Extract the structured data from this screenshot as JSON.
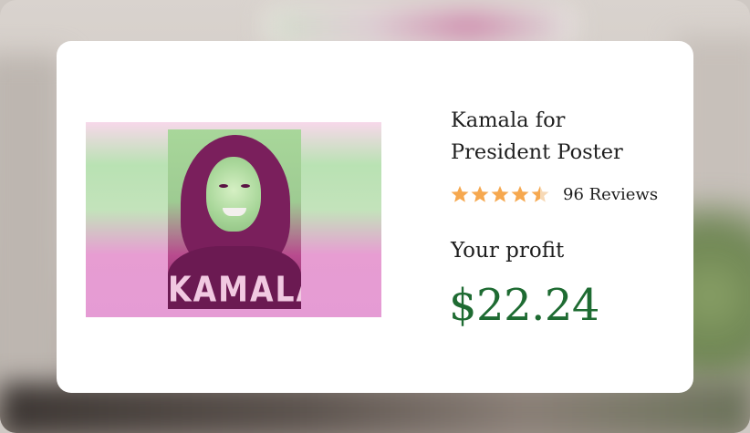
{
  "product": {
    "title_line1": "Kamala for",
    "title_line2": "President Poster",
    "rating": 4.5,
    "reviews_label": "96 Reviews",
    "image_text": "KAMALA",
    "image_icon": "poster-image"
  },
  "profit": {
    "label": "Your profit",
    "value": "$22.24"
  },
  "colors": {
    "star": "#f6a84f",
    "profit": "#1e6b32",
    "card": "#ffffff"
  }
}
